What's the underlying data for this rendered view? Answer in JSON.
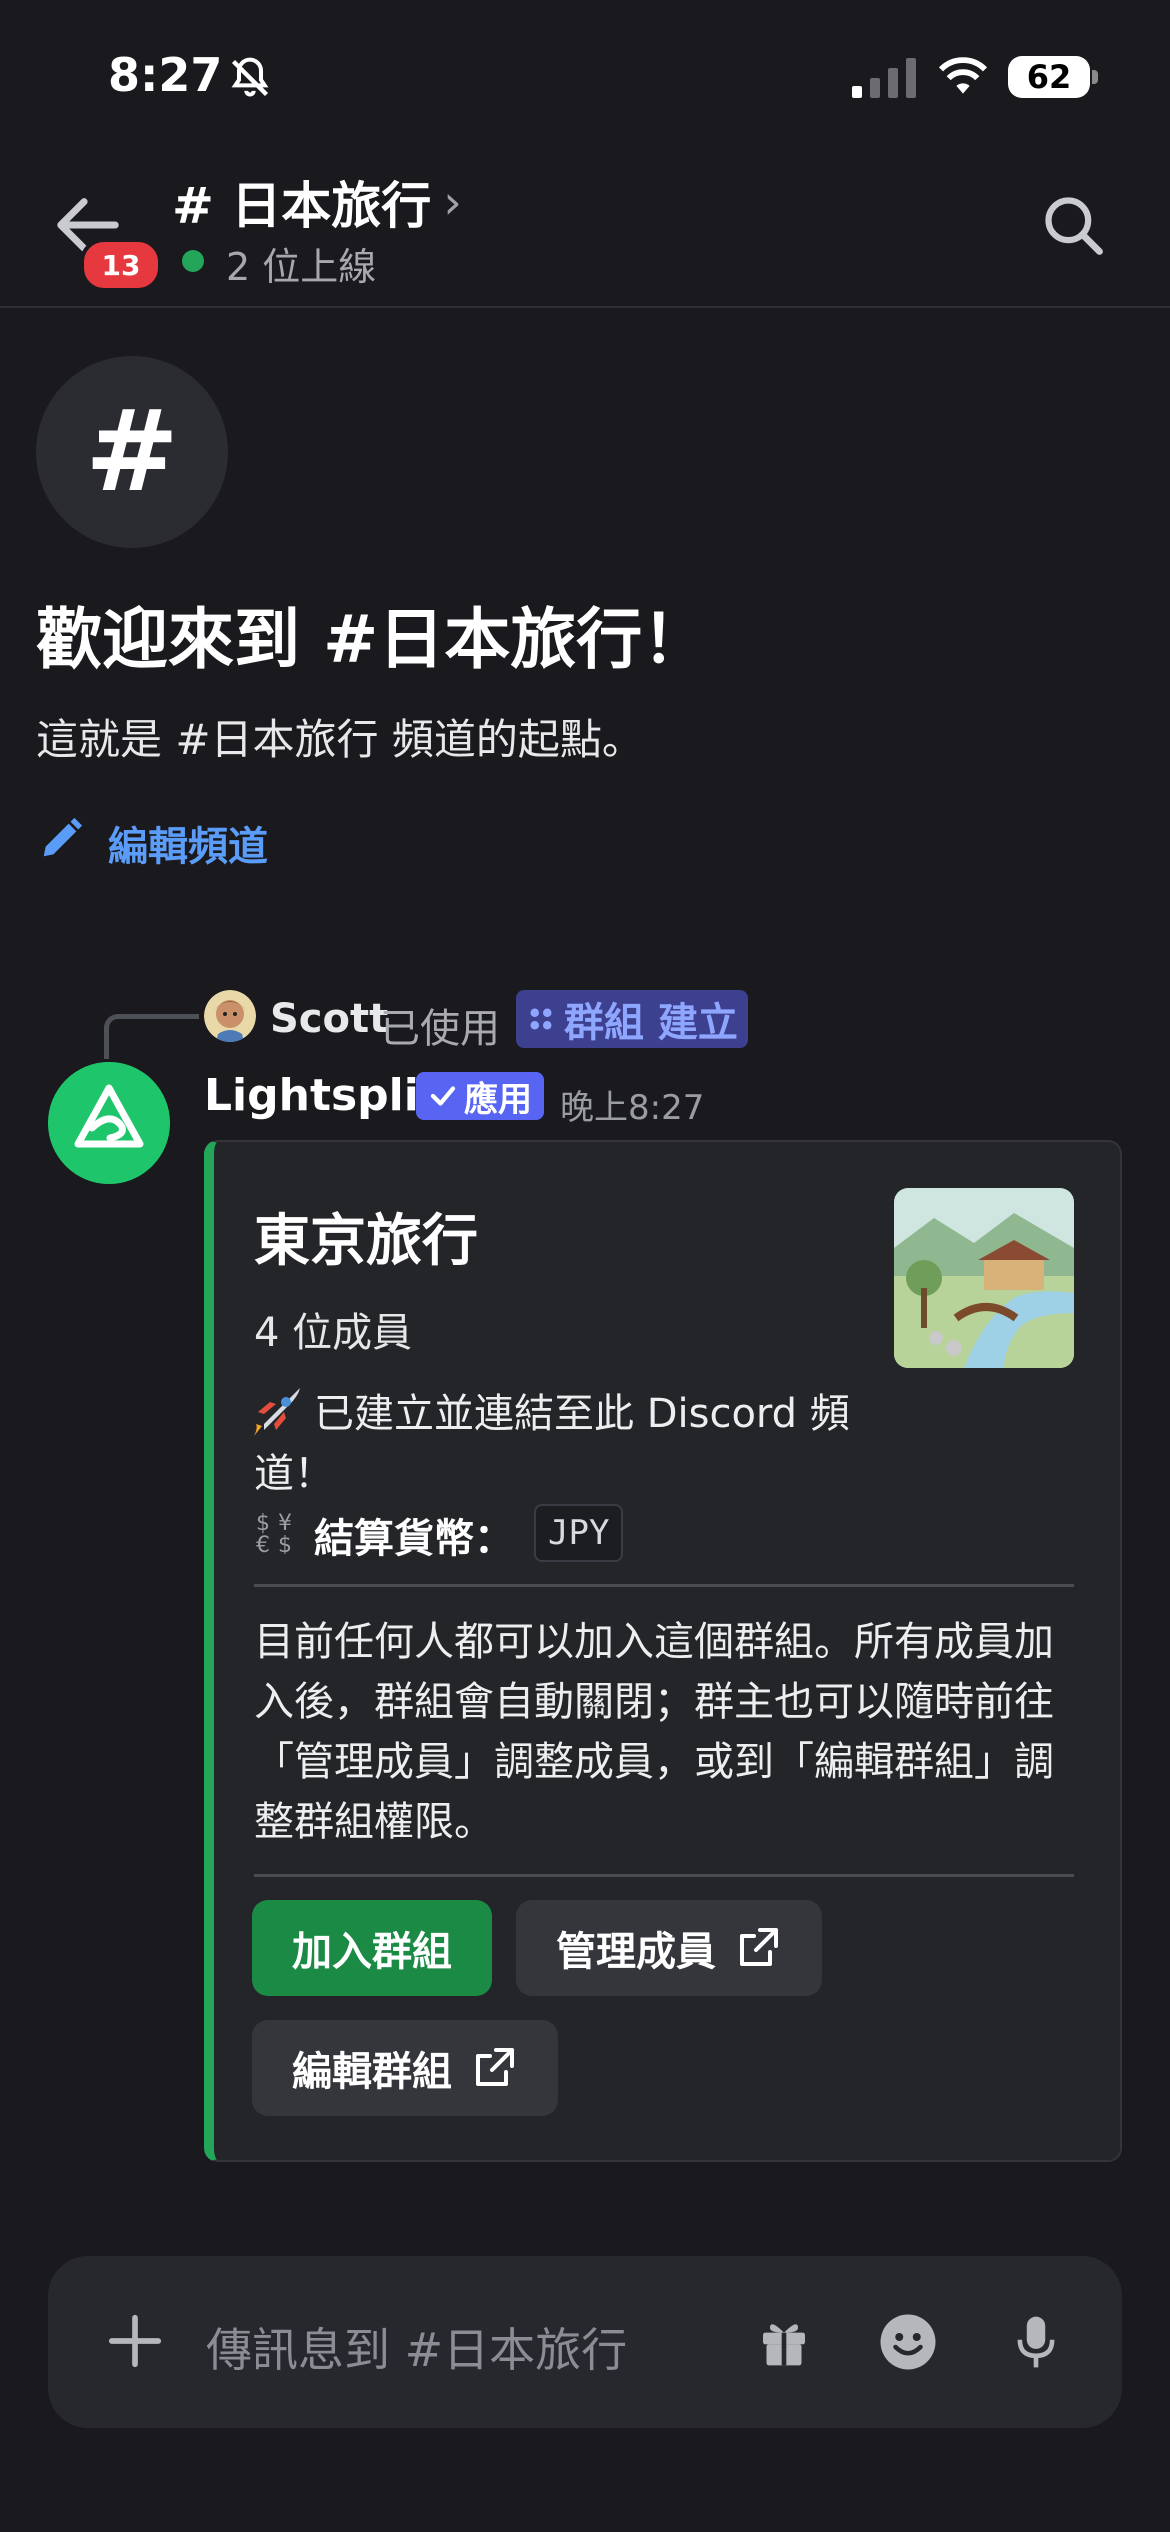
{
  "status_bar": {
    "time": "8:27",
    "battery": "62"
  },
  "header": {
    "unread_badge": "13",
    "channel_title": "# 日本旅行",
    "title_chevron": "›",
    "online_count": "2 位上線"
  },
  "welcome": {
    "hash_symbol": "#",
    "title": "歡迎來到 #日本旅行！",
    "subtitle": "這就是 #日本旅行 頻道的起點。",
    "edit_channel": "編輯頻道"
  },
  "message": {
    "reply_user": "Scott",
    "reply_used": "已使用",
    "command": "群組 建立",
    "bot_name": "Lightsplit",
    "app_tag": "應用",
    "time": "晚上8:27"
  },
  "embed": {
    "title": "東京旅行",
    "members": "4 位成員",
    "created_text": "已建立並連結至此 Discord 頻道！",
    "currency_label": "結算貨幣：",
    "currency_code": "JPY",
    "description": "目前任何人都可以加入這個群組。所有成員加入後，群組會自動關閉；群主也可以隨時前往「管理成員」調整成員，或到「編輯群組」調整群組權限。",
    "buttons": {
      "join": "加入群組",
      "manage": "管理成員",
      "edit": "編輯群組"
    },
    "accent_color": "#23a55a"
  },
  "composer": {
    "placeholder": "傳訊息到 #日本旅行"
  },
  "colors": {
    "background": "#1a1a1e",
    "link": "#5a9cf8",
    "online": "#23a55a",
    "badge": "#e5393f",
    "join_button": "#1a8a45",
    "app_tag": "#5865f2"
  }
}
